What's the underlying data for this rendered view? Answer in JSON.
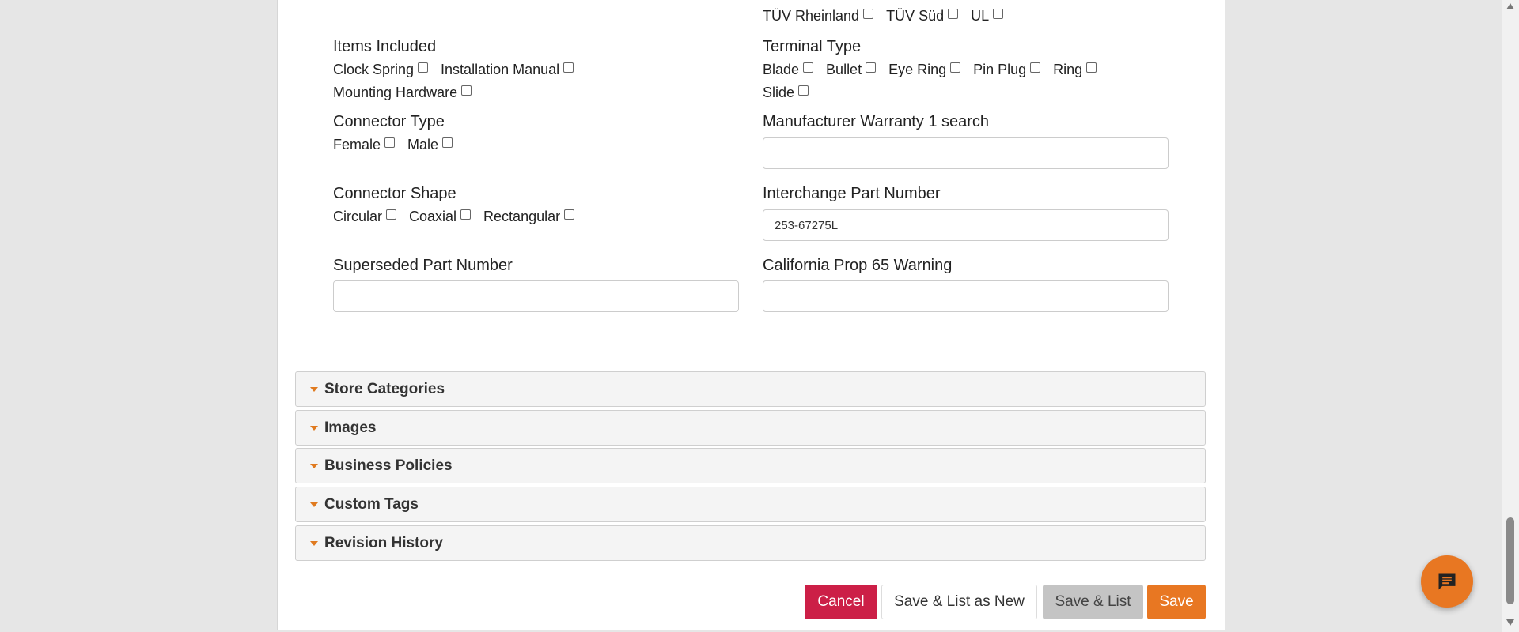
{
  "certifications": {
    "options": [
      "TÜV Rheinland",
      "TÜV Süd",
      "UL"
    ]
  },
  "items_included": {
    "label": "Items Included",
    "options": [
      "Clock Spring",
      "Installation Manual",
      "Mounting Hardware"
    ]
  },
  "terminal_type": {
    "label": "Terminal Type",
    "options": [
      "Blade",
      "Bullet",
      "Eye Ring",
      "Pin Plug",
      "Ring",
      "Slide"
    ]
  },
  "connector_type": {
    "label": "Connector Type",
    "options": [
      "Female",
      "Male"
    ]
  },
  "warranty": {
    "label": "Manufacturer Warranty 1 search",
    "value": ""
  },
  "connector_shape": {
    "label": "Connector Shape",
    "options": [
      "Circular",
      "Coaxial",
      "Rectangular"
    ]
  },
  "interchange": {
    "label": "Interchange Part Number",
    "value": "253-67275L"
  },
  "superseded": {
    "label": "Superseded Part Number",
    "value": ""
  },
  "prop65": {
    "label": "California Prop 65 Warning",
    "value": ""
  },
  "sections": [
    "Store Categories",
    "Images",
    "Business Policies",
    "Custom Tags",
    "Revision History"
  ],
  "buttons": {
    "cancel": "Cancel",
    "save_list_new": "Save & List as New",
    "save_list": "Save & List",
    "save": "Save"
  },
  "colors": {
    "accent": "#e87722",
    "cancel": "#cc1f47",
    "gray": "#c4c4c4"
  }
}
